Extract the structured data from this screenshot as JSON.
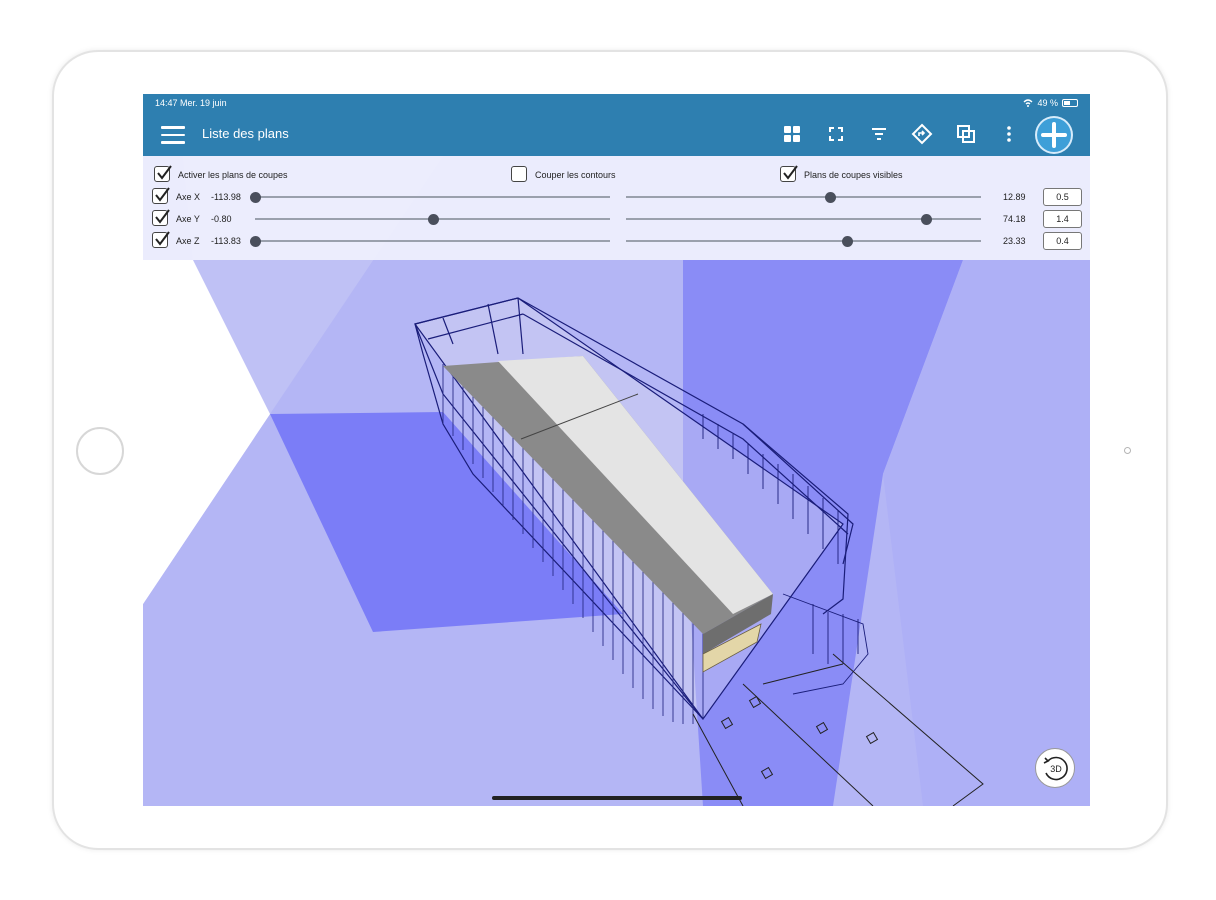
{
  "status_bar": {
    "time": "14:47",
    "date": "Mer. 19 juin",
    "battery": "49 %"
  },
  "toolbar": {
    "title": "Liste des plans",
    "icons": [
      "grid-icon",
      "fullscreen-icon",
      "filter-icon",
      "navigate-icon",
      "copy-icon",
      "more-vertical-icon",
      "add-icon"
    ]
  },
  "section_panel": {
    "activate_label": "Activer les plans de coupes",
    "activate_checked": true,
    "cut_contours_label": "Couper les contours",
    "cut_contours_checked": false,
    "visible_label": "Plans de coupes visibles",
    "visible_checked": true,
    "axes": [
      {
        "label": "Axe X",
        "min_value": "-113.98",
        "max_value": "12.89",
        "step": "0.5",
        "checked": true
      },
      {
        "label": "Axe Y",
        "min_value": "-0.80",
        "max_value": "74.18",
        "step": "1.4",
        "checked": true
      },
      {
        "label": "Axe Z",
        "min_value": "-113.83",
        "max_value": "23.33",
        "step": "0.4",
        "checked": true
      }
    ]
  },
  "view_controls": {
    "rotate_label": "3D"
  },
  "colors": {
    "primary": "#2e7fb0",
    "plane_light": "#b4b6f5",
    "plane_dark": "#7a7cf5",
    "wireframe": "#1a1d7a"
  }
}
